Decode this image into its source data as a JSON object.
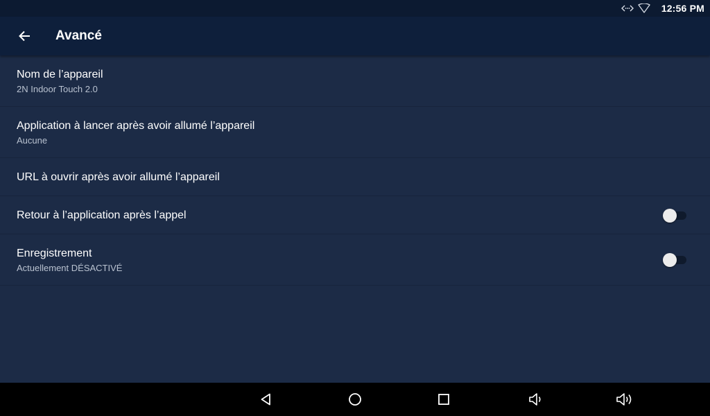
{
  "status_bar": {
    "time": "12:56 PM",
    "icons": [
      "ethernet-icon",
      "wifi-icon"
    ]
  },
  "app_bar": {
    "back_icon": "arrow-left-icon",
    "title": "Avancé"
  },
  "settings": [
    {
      "title": "Nom de l’appareil",
      "subtitle": "2N Indoor Touch 2.0"
    },
    {
      "title": "Application à lancer après avoir allumé l’appareil",
      "subtitle": "Aucune"
    },
    {
      "title": "URL à ouvrir après avoir allumé l’appareil"
    },
    {
      "title": "Retour à l’application après l’appel",
      "toggle_on": false
    },
    {
      "title": "Enregistrement",
      "subtitle": "Actuellement DÉSACTIVÉ",
      "toggle_on": false
    }
  ],
  "nav_bar": {
    "icons": [
      "back-triangle-icon",
      "home-circle-icon",
      "recents-square-icon",
      "volume-down-icon",
      "volume-up-icon"
    ]
  },
  "colors": {
    "status_bar_bg": "#0c1a31",
    "app_bar_bg": "#0e1f3b",
    "content_bg": "#1c2b46",
    "nav_bar_bg": "#000000",
    "text_primary": "#ffffff",
    "text_secondary": "#b9c2d0"
  }
}
